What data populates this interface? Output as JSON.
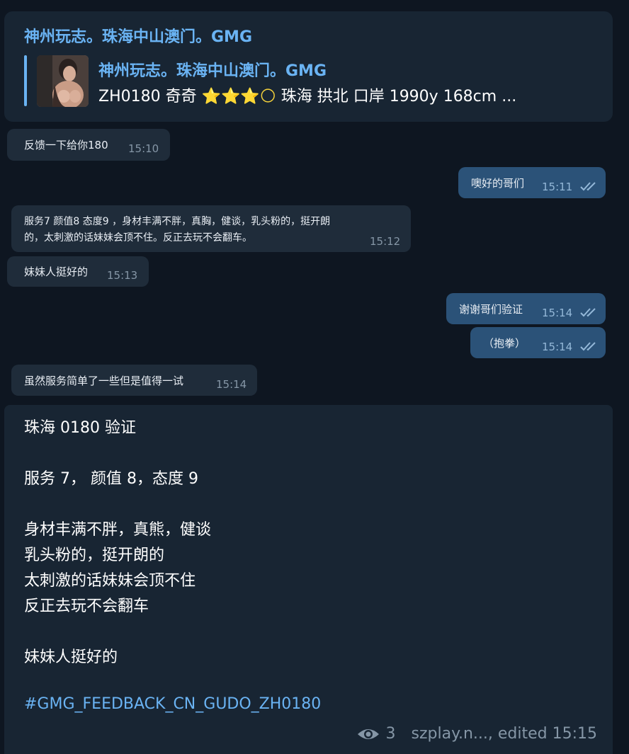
{
  "header": {
    "title": "神州玩志。珠海中山澳门。GMG",
    "reply": {
      "name": "神州玩志。珠海中山澳门。GMG",
      "text_prefix": "ZH0180 奇奇 ",
      "stars": "⭐⭐⭐",
      "moon": "🌕",
      "text_suffix": " 珠海 拱北 口岸 1990y  168cm ..."
    }
  },
  "messages": [
    {
      "dir": "in",
      "text": "反馈一下给你180",
      "time": "15:10"
    },
    {
      "dir": "out",
      "text": "噢好的哥们",
      "time": "15:11"
    },
    {
      "dir": "in",
      "text_line1": "服务7 颜值8 态度9 ，身材丰满不胖，真胸，健谈，乳头粉的，挺开朗",
      "text_line2": "的，太刺激的话妹妹会顶不住。反正去玩不会翻车。",
      "time": "15:12"
    },
    {
      "dir": "in",
      "text": "妹妹人挺好的",
      "time": "15:13"
    },
    {
      "dir": "out",
      "text": "谢谢哥们验证",
      "time": "15:14"
    },
    {
      "dir": "out",
      "text": "（抱拳）",
      "time": "15:14"
    },
    {
      "dir": "in",
      "text": "虽然服务简单了一些但是值得一试",
      "time": "15:14"
    }
  ],
  "post": {
    "lines": [
      "珠海 0180 验证",
      "服务 7， 颜值 8，态度 9",
      "身材丰满不胖，真熊，健谈",
      "乳头粉的，挺开朗的",
      "太刺激的话妹妹会顶不住",
      "反正去玩不会翻车",
      "妹妹人挺好的"
    ],
    "hashtag": "#GMG_FEEDBACK_CN_GUDO_ZH0180",
    "views": "3",
    "footer_meta": "szplay.n..., edited 15:15"
  },
  "icons": {
    "views": "eye-icon",
    "read": "double-check-icon"
  },
  "colors": {
    "background": "#0e1621",
    "card": "#182533",
    "incoming": "#1f2c3a",
    "outgoing": "#2b5278",
    "accent": "#6ab3f3"
  }
}
